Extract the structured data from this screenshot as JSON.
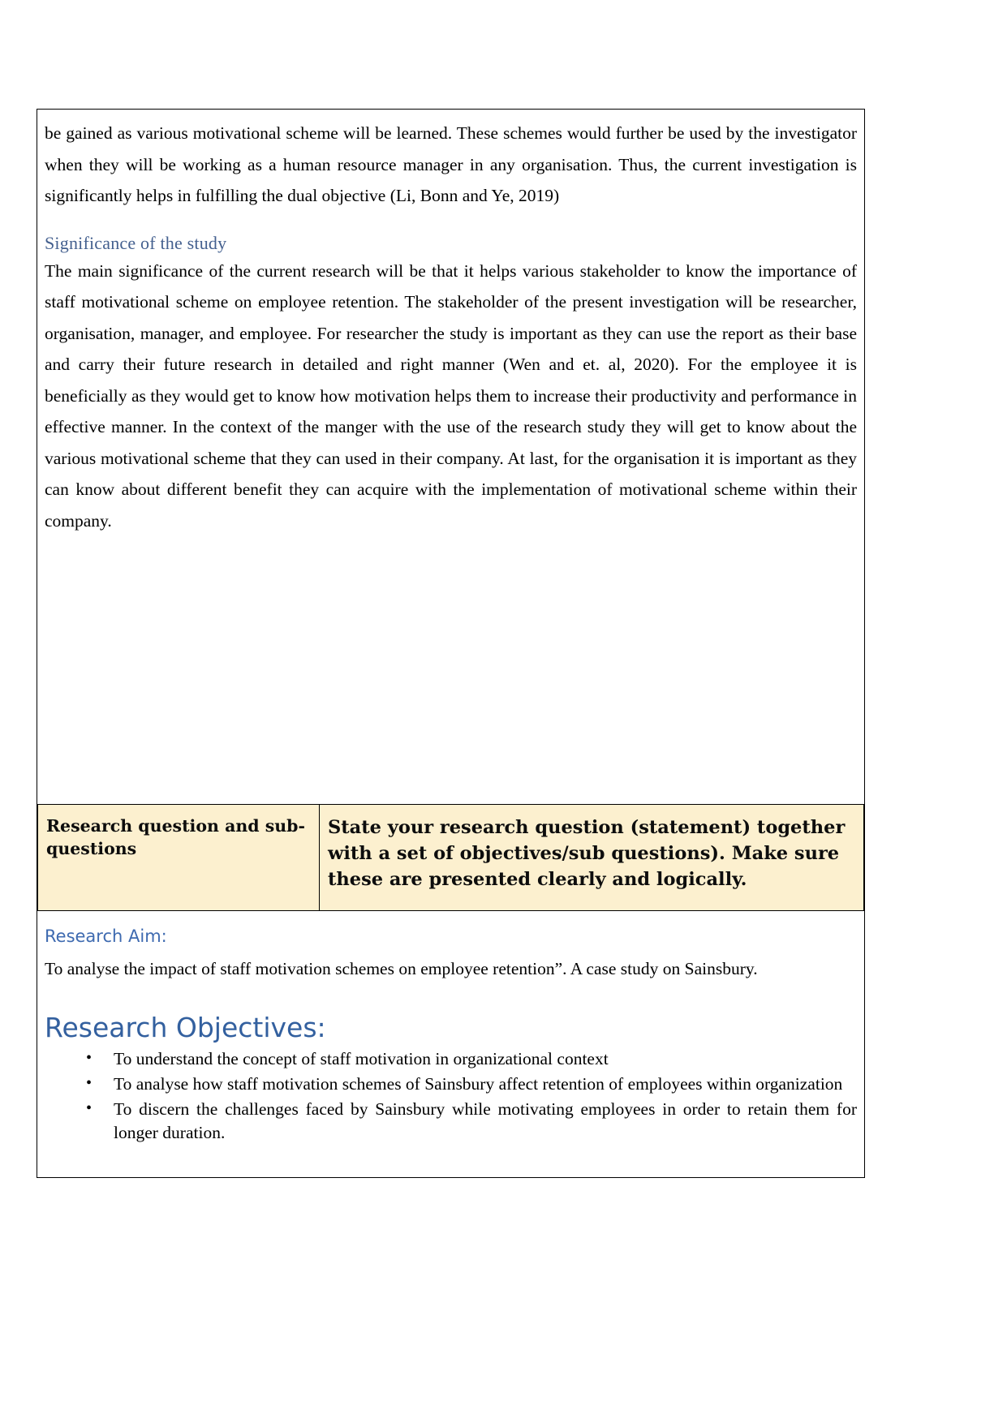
{
  "document": {
    "top_paragraph": "be gained as various motivational scheme will be learned. These schemes would further be used by the investigator when they will be working as a human resource manager in any organisation. Thus, the current investigation is significantly helps in fulfilling the dual objective (Li, Bonn and Ye, 2019)",
    "significance_heading": "Significance of the study",
    "significance_paragraph": "The main significance of the current research will be that it helps various stakeholder to know the importance of staff motivational scheme on employee retention. The stakeholder of the present investigation will be researcher, organisation, manager, and employee. For researcher the study is important as they can use the report as their base and carry their future research in detailed and right manner (Wen and et. al, 2020). For the employee it is beneficially as they would get to know how motivation helps them to increase their productivity and performance in effective manner. In the context of the manger with the use of the research study they will get to know about the various motivational scheme that they can used in their company. At last, for the organisation it is important as they can know about different benefit they can acquire with the implementation of motivational scheme within their company."
  },
  "requirement_table": {
    "row_label": "Research question and sub-questions",
    "row_instruction": "State your research question (statement) together with a set of objectives/sub questions). Make sure these are presented clearly and logically."
  },
  "research_aim": {
    "heading": "Research Aim:",
    "text": "To analyse the impact of staff motivation schemes on employee retention”. A case study on Sainsbury."
  },
  "research_objectives": {
    "heading": "Research Objectives:",
    "bullet_glyph": "•",
    "items": [
      "To understand the concept of staff motivation in organizational context",
      "To analyse how staff motivation schemes of Sainsbury affect retention of employees within organization",
      "To discern the challenges faced by Sainsbury while motivating employees in order to retain them for longer duration."
    ]
  },
  "colors": {
    "heading_blue_serif": "#44608f",
    "heading_blue_sans": "#3e6ab0",
    "objectives_blue": "#33609f",
    "table_fill": "#fcf0cf",
    "border": "#000000"
  }
}
